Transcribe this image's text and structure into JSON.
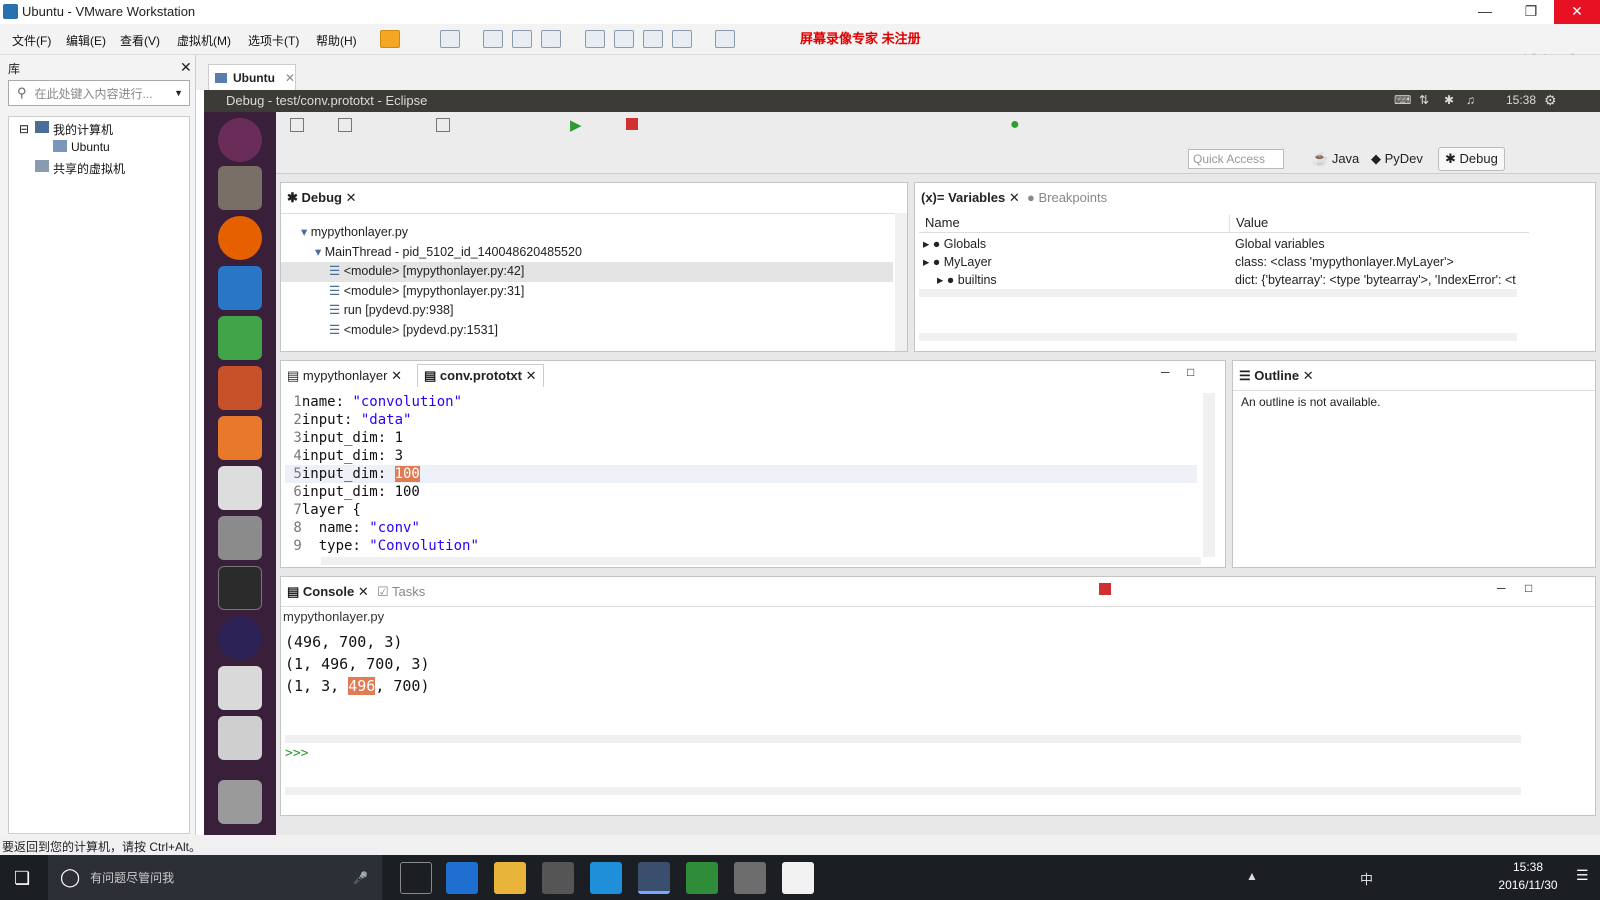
{
  "vm": {
    "window_title": "Ubuntu - VMware Workstation",
    "menu": [
      "文件(F)",
      "编辑(E)",
      "查看(V)",
      "虚拟机(M)",
      "选项卡(T)",
      "帮助(H)"
    ],
    "watermark": "屏幕录像专家  未注册",
    "logo_text": "51CTO学院",
    "library_label": "库",
    "library_search_placeholder": "在此处键入内容进行...",
    "tree": [
      "我的计算机",
      "Ubuntu",
      "共享的虚拟机"
    ],
    "tab_label": "Ubuntu",
    "status_text": "要返回到您的计算机，请按 Ctrl+Alt。"
  },
  "guest": {
    "top_title": "Debug - test/conv.prototxt - Eclipse",
    "clock": "15:38"
  },
  "eclipse": {
    "quick_access_placeholder": "Quick Access",
    "perspectives": [
      "Java",
      "PyDev",
      "Debug"
    ],
    "debug_view": {
      "tab": "Debug",
      "items": [
        {
          "label": "mypythonlayer.py",
          "indent": 1
        },
        {
          "label": "MainThread - pid_5102_id_140048620485520",
          "indent": 2
        },
        {
          "label": "<module> [mypythonlayer.py:42]",
          "indent": 3,
          "selected": true
        },
        {
          "label": "<module> [mypythonlayer.py:31]",
          "indent": 3
        },
        {
          "label": "run [pydevd.py:938]",
          "indent": 3
        },
        {
          "label": "<module> [pydevd.py:1531]",
          "indent": 3
        }
      ]
    },
    "variables_view": {
      "tabs": [
        "Variables",
        "Breakpoints"
      ],
      "headers": [
        "Name",
        "Value"
      ],
      "rows": [
        {
          "name": "Globals",
          "value": "Global variables"
        },
        {
          "name": "MyLayer",
          "value": "class: <class 'mypythonlayer.MyLayer'>"
        },
        {
          "name": "builtins",
          "value": "dict: {'bytearray': <type 'bytearray'>, 'IndexError': <t"
        }
      ]
    },
    "editor": {
      "tabs": [
        "mypythonlayer",
        "conv.prototxt"
      ],
      "active_tab": 1,
      "lines": [
        {
          "n": "1",
          "pre": "name: ",
          "str": "\"convolution\"",
          "post": ""
        },
        {
          "n": "2",
          "pre": "input: ",
          "str": "\"data\"",
          "post": ""
        },
        {
          "n": "3",
          "pre": "input_dim: 1",
          "str": "",
          "post": ""
        },
        {
          "n": "4",
          "pre": "input_dim: 3",
          "str": "",
          "post": ""
        },
        {
          "n": "5",
          "pre": "input_dim: ",
          "hl": "100",
          "str": "",
          "post": "",
          "current": true
        },
        {
          "n": "6",
          "pre": "input_dim: 100",
          "str": "",
          "post": ""
        },
        {
          "n": "7",
          "pre": "layer {",
          "str": "",
          "post": ""
        },
        {
          "n": "8",
          "pre": "  name: ",
          "str": "\"conv\"",
          "post": ""
        },
        {
          "n": "9",
          "pre": "  type: ",
          "str": "\"Convolution\"",
          "post": ""
        }
      ]
    },
    "outline_view": {
      "tab": "Outline",
      "message": "An outline is not available."
    },
    "console_view": {
      "tabs": [
        "Console",
        "Tasks"
      ],
      "process": "mypythonlayer.py",
      "lines": [
        {
          "pre": "(496, 700, 3)",
          "hl": "",
          "post": ""
        },
        {
          "pre": "(1, 496, 700, 3)",
          "hl": "",
          "post": ""
        },
        {
          "pre": "(1, 3, ",
          "hl": "496",
          "post": ", 700)"
        }
      ],
      "prompt": ">>>"
    }
  },
  "taskbar": {
    "search_placeholder": "有问题尽管问我",
    "time": "15:38",
    "date": "2016/11/30",
    "ime": "中"
  },
  "colors": {
    "launcher": "#3a1f3a",
    "highlight": "#e07b53",
    "taskbar": "#1b1f24"
  }
}
